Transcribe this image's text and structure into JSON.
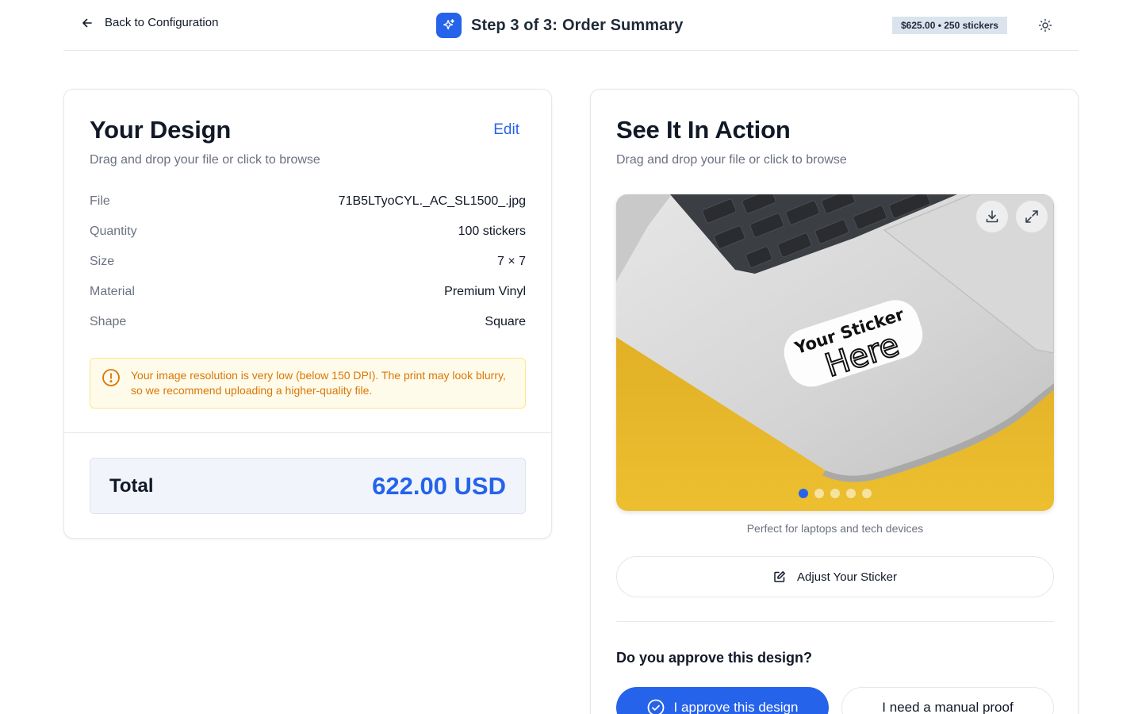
{
  "header": {
    "back_label": "Back to Configuration",
    "step_label": "Step 3 of 3:",
    "title": "Order Summary",
    "price_badge": "$625.00 • 250 stickers"
  },
  "design_card": {
    "title": "Your Design",
    "edit_label": "Edit",
    "subtitle": "Drag and drop your file or click to browse",
    "details": [
      {
        "label": "File",
        "value": "71B5LTyoCYL._AC_SL1500_.jpg"
      },
      {
        "label": "Quantity",
        "value": "100 stickers"
      },
      {
        "label": "Size",
        "value": "7 × 7"
      },
      {
        "label": "Material",
        "value": "Premium Vinyl"
      },
      {
        "label": "Shape",
        "value": "Square"
      }
    ],
    "warning": "Your image resolution is very low (below 150 DPI). The print may look blurry, so we recommend uploading a higher-quality file.",
    "total_label": "Total",
    "total_value": "622.00 USD"
  },
  "preview_card": {
    "title": "See It In Action",
    "subtitle": "Drag and drop your file or click to browse",
    "sticker_line1": "Your Sticker",
    "sticker_line2": "Here",
    "active_slide": 1,
    "slide_count": 5,
    "caption": "Perfect for laptops and tech devices",
    "adjust_label": "Adjust Your Sticker",
    "question": "Do you approve this design?",
    "approve_label": "I approve this design",
    "proof_label": "I need a manual proof"
  },
  "colors": {
    "accent": "#2563eb",
    "warning_text": "#d97706",
    "warning_bg": "#fffbeb",
    "backdrop": "#e9b92a"
  }
}
